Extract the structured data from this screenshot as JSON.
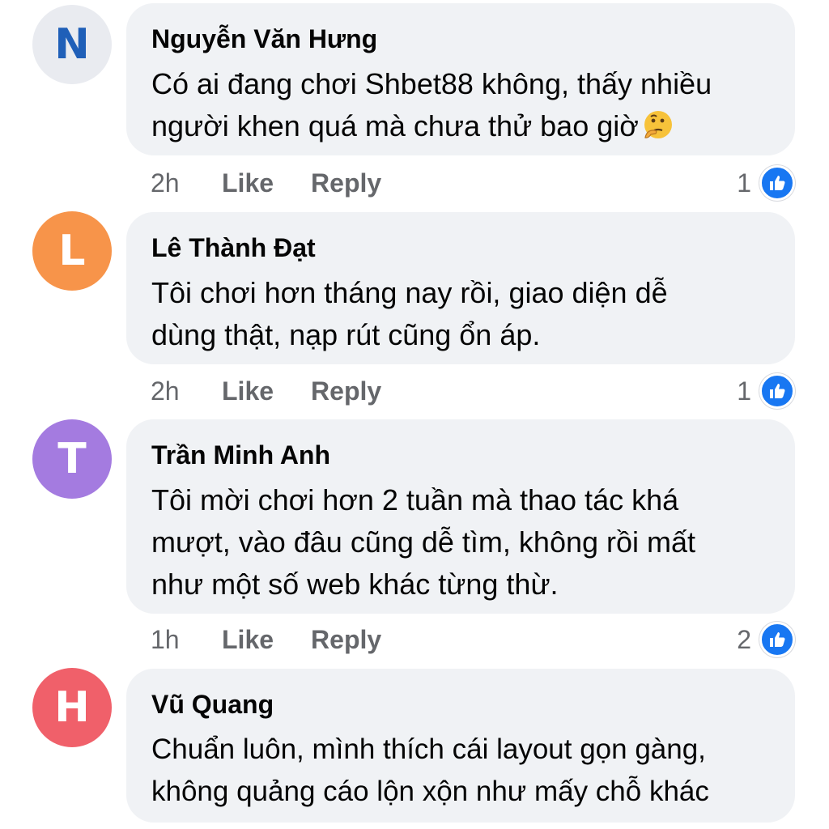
{
  "colors": {
    "bubble": "#f0f2f5",
    "meta_text": "#65676b",
    "like_blue": "#1877f2"
  },
  "labels": {
    "like": "Like",
    "reply": "Reply"
  },
  "comments": [
    {
      "avatar_letter": "N",
      "avatar_bg": "#e9ebf0",
      "avatar_fg": "#1f5fb8",
      "author": "Nguyễn Văn Hưng",
      "text": "Có ai đang chơi Shbet88 không, thấy nhiều\nngười khen quá mà chưa thử bao giờ",
      "emoji": "thinking-face",
      "time": "2h",
      "likes": "1"
    },
    {
      "avatar_letter": "L",
      "avatar_bg": "#f7944a",
      "avatar_fg": "#ffffff",
      "author": "Lê Thành Đạt",
      "text": "Tôi chơi hơn tháng nay rồi, giao diện dễ\ndùng thật, nạp rút cũng ổn áp.",
      "time": "2h",
      "likes": "1"
    },
    {
      "avatar_letter": "T",
      "avatar_bg": "#a47be0",
      "avatar_fg": "#ffffff",
      "author": "Trần Minh Anh",
      "text": "Tôi mời chơi hơn 2 tuần mà thao tác khá\nmượt, vào đâu cũng dễ tìm, không rồi mất\nnhư một số web khác từng thừ.",
      "time": "1h",
      "likes": "2"
    },
    {
      "avatar_letter": "H",
      "avatar_bg": "#f0606a",
      "avatar_fg": "#ffffff",
      "author": "Vũ Quang",
      "text": "Chuẩn luôn, mình thích cái layout gọn gàng,\nkhông quảng cáo lộn xộn như mấy chỗ khác"
    }
  ]
}
